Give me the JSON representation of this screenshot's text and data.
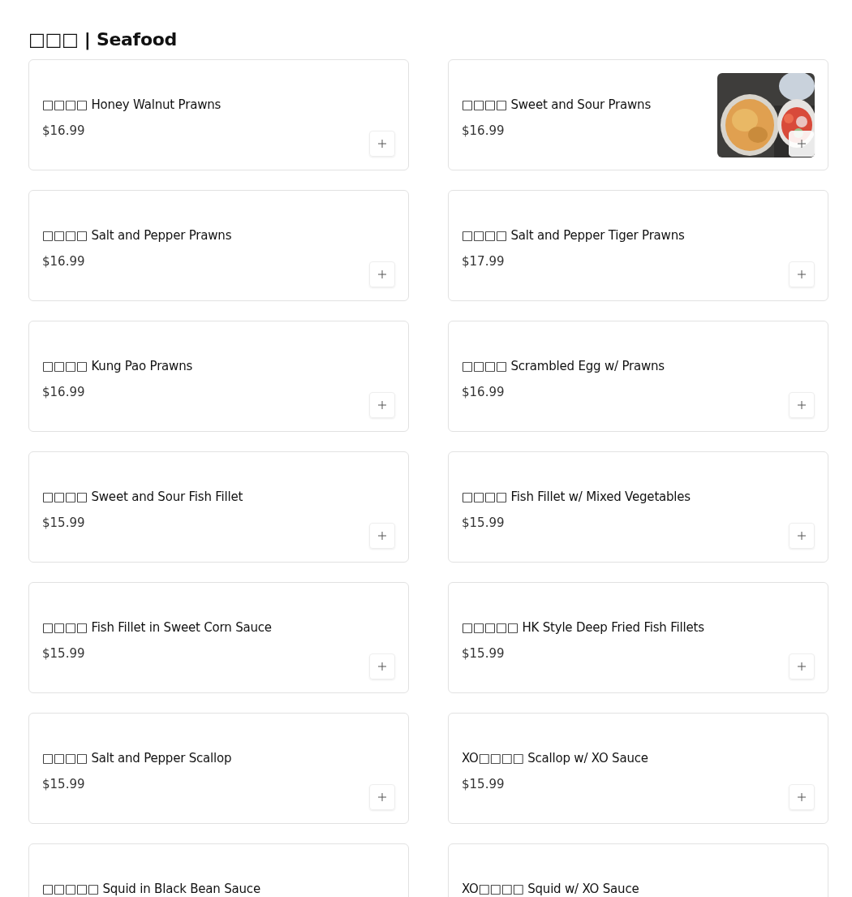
{
  "section": {
    "title": "□□□ | Seafood"
  },
  "items": [
    {
      "name": "□□□□ Honey Walnut Prawns",
      "price": "$16.99"
    },
    {
      "name": "□□□□ Sweet and Sour Prawns",
      "price": "$16.99"
    },
    {
      "name": "□□□□ Salt and Pepper Prawns",
      "price": "$16.99"
    },
    {
      "name": "□□□□ Salt and Pepper Tiger Prawns",
      "price": "$17.99"
    },
    {
      "name": "□□□□ Kung Pao Prawns",
      "price": "$16.99"
    },
    {
      "name": "□□□□ Scrambled Egg w/ Prawns",
      "price": "$16.99"
    },
    {
      "name": "□□□□ Sweet and Sour Fish Fillet",
      "price": "$15.99"
    },
    {
      "name": "□□□□ Fish Fillet w/ Mixed Vegetables",
      "price": "$15.99"
    },
    {
      "name": "□□□□ Fish Fillet in Sweet Corn Sauce",
      "price": "$15.99"
    },
    {
      "name": "□□□□□ HK Style Deep Fried Fish Fillets",
      "price": "$15.99"
    },
    {
      "name": "□□□□ Salt and Pepper Scallop",
      "price": "$15.99"
    },
    {
      "name": "XO□□□□ Scallop w/ XO Sauce",
      "price": "$15.99"
    },
    {
      "name": "□□□□□ Squid in Black Bean Sauce"
    },
    {
      "name": "XO□□□□ Squid w/ XO Sauce"
    }
  ]
}
